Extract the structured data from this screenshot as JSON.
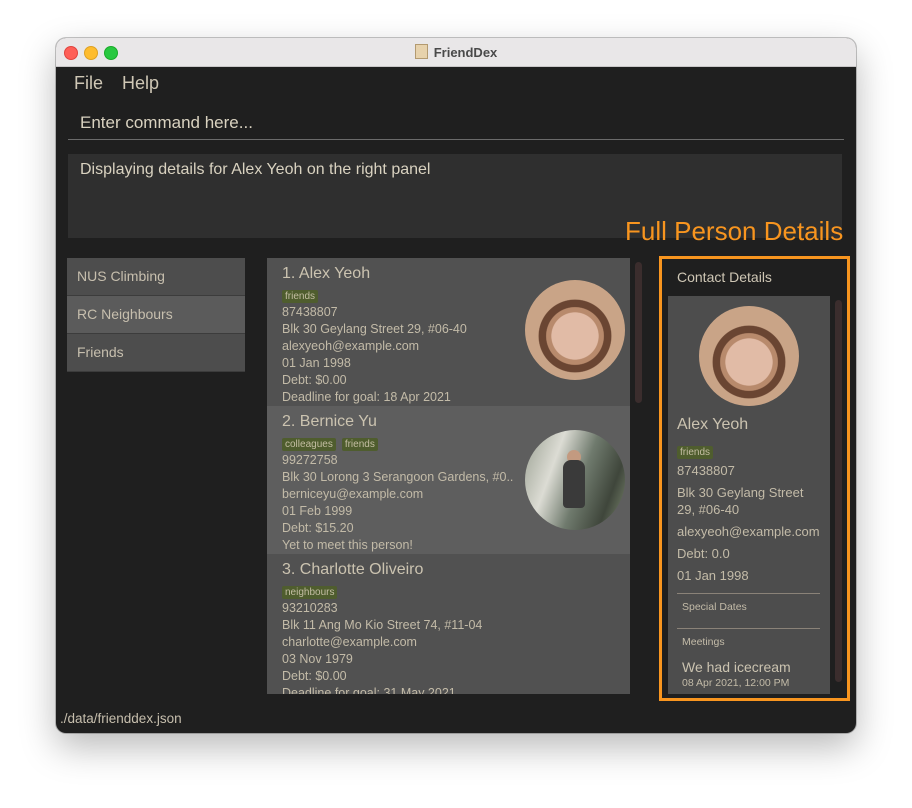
{
  "window": {
    "title": "FriendDex"
  },
  "menu": {
    "file": "File",
    "help": "Help"
  },
  "command_box": {
    "placeholder": "Enter command here..."
  },
  "result_display": {
    "text": "Displaying details for Alex Yeoh on the right panel"
  },
  "annotation": {
    "label": "Full Person Details",
    "color": "#f8951f"
  },
  "groups": [
    {
      "label": "NUS Climbing"
    },
    {
      "label": "RC Neighbours"
    },
    {
      "label": "Friends"
    }
  ],
  "persons": [
    {
      "name": "1.  Alex Yeoh",
      "tags": [
        "friends"
      ],
      "phone": "87438807",
      "address": "Blk 30 Geylang Street 29, #06-40",
      "email": "alexyeoh@example.com",
      "birthday": "01 Jan 1998",
      "debt": "Debt: $0.00",
      "extra": "Deadline for goal: 18 Apr 2021"
    },
    {
      "name": "2.  Bernice Yu",
      "tags": [
        "colleagues",
        "friends"
      ],
      "phone": "99272758",
      "address": "Blk 30 Lorong 3 Serangoon Gardens, #0...",
      "email": "berniceyu@example.com",
      "birthday": "01 Feb 1999",
      "debt": "Debt: $15.20",
      "extra": "Yet to meet this person!"
    },
    {
      "name": "3.  Charlotte Oliveiro",
      "tags": [
        "neighbours"
      ],
      "phone": "93210283",
      "address": "Blk 11 Ang Mo Kio Street 74, #11-04",
      "email": "charlotte@example.com",
      "birthday": "03 Nov 1979",
      "debt": "Debt: $0.00",
      "extra": "Deadline for goal: 31 May 2021"
    }
  ],
  "details": {
    "header": "Contact Details",
    "name": "Alex Yeoh",
    "tag": "friends",
    "phone": "87438807",
    "address": "Blk 30 Geylang Street 29, #06-40",
    "email": "alexyeoh@example.com",
    "debt": "Debt: 0.0",
    "birthday": "01 Jan 1998",
    "special_dates_label": "Special Dates",
    "meetings_label": "Meetings",
    "meeting": {
      "title": "We had icecream",
      "time": "08 Apr 2021, 12:00 PM"
    }
  },
  "status_bar": {
    "path": "./data/frienddex.json"
  }
}
